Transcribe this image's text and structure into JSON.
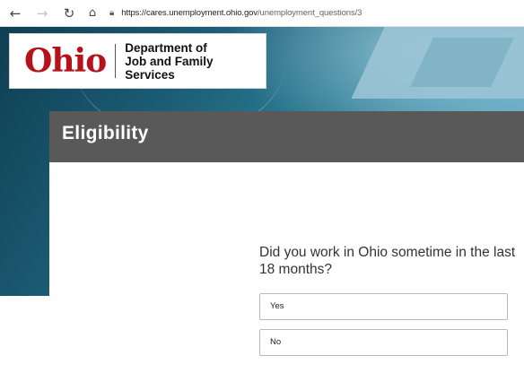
{
  "browser": {
    "url_host": "https://cares.unemployment.ohio.gov",
    "url_path": "/unemployment_questions/3"
  },
  "header": {
    "logo_word": "Ohio",
    "dept_line1": "Department of",
    "dept_line2": "Job and Family Services"
  },
  "page": {
    "title": "Eligibility",
    "question": "Did you work in Ohio sometime in the last 18 months?",
    "options": [
      "Yes",
      "No"
    ]
  },
  "colors": {
    "brand_red": "#b5121b",
    "title_bar": "#595959",
    "hero_teal": "#1b5c74"
  }
}
